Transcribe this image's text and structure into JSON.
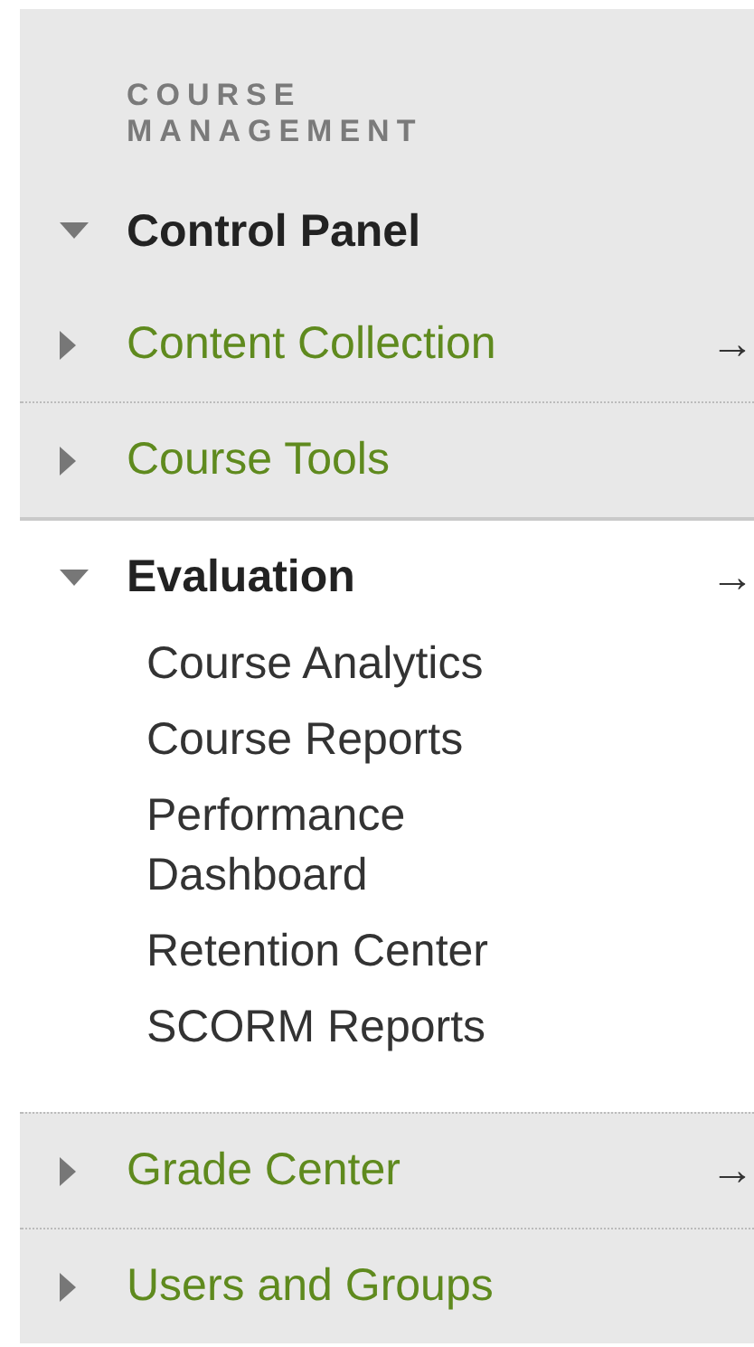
{
  "heading": "COURSE MANAGEMENT",
  "menu": [
    {
      "label": "Control Panel",
      "expanded": true,
      "children": [
        {
          "label": "Content Collection",
          "expanded": false,
          "arrow": "→"
        },
        {
          "label": "Course Tools",
          "expanded": false
        },
        {
          "label": "Evaluation",
          "expanded": true,
          "arrow": "→",
          "children": [
            {
              "label": "Course Analytics"
            },
            {
              "label": "Course Reports"
            },
            {
              "label": "Performance Dashboard"
            },
            {
              "label": "Retention Center"
            },
            {
              "label": "SCORM Reports"
            }
          ]
        },
        {
          "label": "Grade Center",
          "expanded": false,
          "arrow": "→"
        },
        {
          "label": "Users and Groups",
          "expanded": false
        }
      ]
    }
  ]
}
